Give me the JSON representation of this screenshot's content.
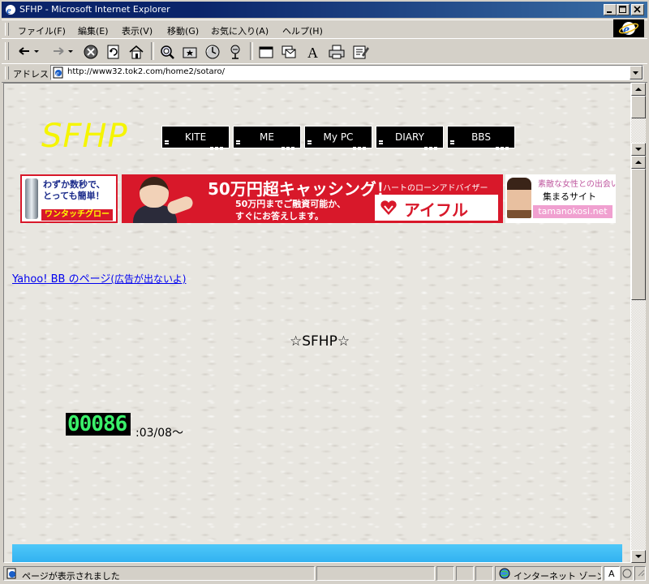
{
  "window": {
    "title": "SFHP - Microsoft Internet Explorer"
  },
  "menubar": {
    "items": [
      "ファイル(F)",
      "編集(E)",
      "表示(V)",
      "移動(G)",
      "お気に入り(A)",
      "ヘルプ(H)"
    ]
  },
  "toolbar": {
    "buttons": [
      "back-icon",
      "forward-icon",
      "stop-icon",
      "refresh-icon",
      "home-icon",
      "search-icon",
      "favorites-icon",
      "history-icon",
      "channels-icon",
      "fullscreen-icon",
      "mail-icon",
      "font-icon",
      "print-icon",
      "edit-icon"
    ]
  },
  "address": {
    "label": "アドレス",
    "url": "http://www32.tok2.com/home2/sotaro/"
  },
  "page": {
    "logo": "SFHP",
    "nav": [
      "KITE",
      "ME",
      "My PC",
      "DIARY",
      "BBS"
    ],
    "ads": {
      "ad1": {
        "line1": "わずか数秒で、",
        "line2": "とっても簡単！",
        "band": "ワンタッチグロー"
      },
      "ad2": {
        "headline": "50万円超キャッシング！",
        "tag": "ハートのローンアドバイザー",
        "sub1": "50万円までご融資可能か、",
        "sub2": "すぐにお答えします。",
        "brand": "アイフル"
      },
      "ad3": {
        "line1": "素敵な女性との出会い",
        "line2": "集まるサイト",
        "domain": "tamanokosi.net"
      }
    },
    "yahoo_link": "Yahoo! BB のページ",
    "yahoo_note": "(広告が出ないよ)",
    "center_title": "☆SFHP☆",
    "counter": "00086",
    "since": ":03/08〜"
  },
  "status": {
    "text": "ページが表示されました",
    "zone": "インターネット ゾーン",
    "ime": "A"
  },
  "colors": {
    "titlebar": "#0a246a",
    "logo": "#f5f500",
    "counter_digits": "#3af06a",
    "link": "#0000ee",
    "ad_red": "#d8182a",
    "bottom_bar": "#2fb0f0"
  }
}
